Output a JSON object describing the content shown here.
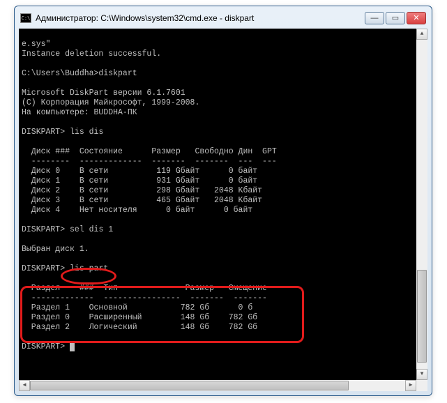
{
  "window": {
    "title": "Администратор: C:\\Windows\\system32\\cmd.exe - diskpart",
    "icon_label": "C:\\"
  },
  "console": {
    "line_esys": "e.sys\"",
    "line_deleted": "Instance deletion successful.",
    "prompt_user": "C:\\Users\\Buddha>diskpart",
    "dp_version": "Microsoft DiskPart версии 6.1.7601",
    "dp_copyright": "(C) Корпорация Майкрософт, 1999-2008.",
    "dp_computer": "На компьютере: BUDDHA-ПК",
    "dp_prompt": "DISKPART>",
    "cmd_lisdis": "lis dis",
    "disk_header": "  Диск ###  Состояние      Размер   Свободно Дин  GPT",
    "disk_divider": "  --------  -------------  -------  -------  ---  ---",
    "disks": [
      "  Диск 0    В сети          119 Gбайт      0 байт",
      "  Диск 1    В сети          931 Gбайт      0 байт",
      "  Диск 2    В сети          298 Gбайт   2048 Kбайт",
      "  Диск 3    В сети          465 Gбайт   2048 Kбайт",
      "  Диск 4    Нет носителя      0 байт      0 байт"
    ],
    "cmd_seldis": "sel dis 1",
    "seldis_result": "Выбран диск 1.",
    "cmd_lispart": "lis part",
    "part_header": "  Раздел    ###  Тип              Размер   Смещение",
    "part_divider": "  -------------  ----------------  -------  -------",
    "parts": [
      "  Раздел 1    Основной           782 Gб      0 б",
      "  Раздел 0    Расширенный        148 Gб    782 Gб",
      "  Раздел 2    Логический         148 Gб    782 Gб"
    ]
  }
}
